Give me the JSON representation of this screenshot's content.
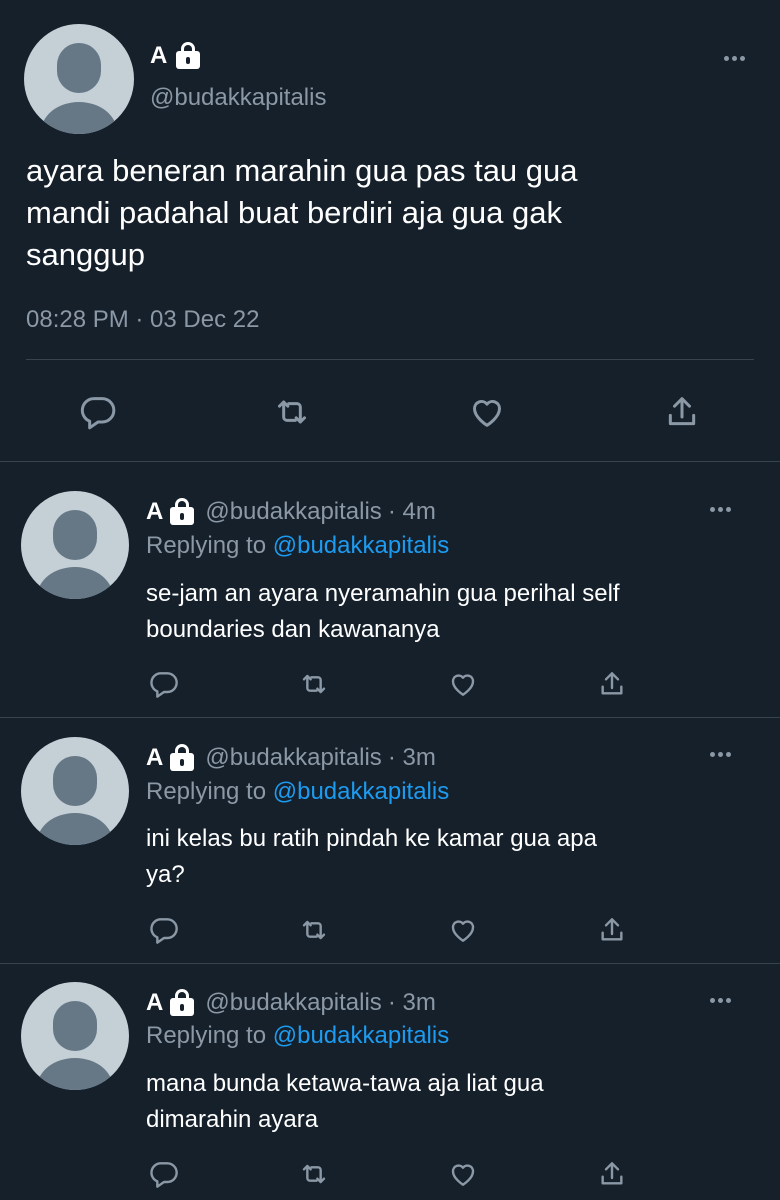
{
  "main_tweet": {
    "name": "A",
    "handle": "@budakkapitalis",
    "text_lines": [
      "ayara beneran marahin gua pas tau gua",
      "mandi padahal buat berdiri aja gua gak",
      "sanggup"
    ],
    "timestamp": "08:28 PM · 03 Dec 22"
  },
  "replies": [
    {
      "name": "A",
      "handle": "@budakkapitalis",
      "time": "· 4m",
      "replying_label": "Replying to",
      "replying_handle": "@budakkapitalis",
      "text_lines": [
        "se-jam an ayara nyeramahin gua perihal self",
        "boundaries dan kawananya"
      ]
    },
    {
      "name": "A",
      "handle": "@budakkapitalis",
      "time": "· 3m",
      "replying_label": "Replying to",
      "replying_handle": "@budakkapitalis",
      "text_lines": [
        "ini kelas bu ratih pindah ke kamar gua apa",
        "ya?"
      ]
    },
    {
      "name": "A",
      "handle": "@budakkapitalis",
      "time": "· 3m",
      "replying_label": "Replying to",
      "replying_handle": "@budakkapitalis",
      "text_lines": [
        "mana bunda ketawa-tawa aja liat gua",
        "dimarahin ayara"
      ]
    }
  ],
  "icons": {
    "reply": "reply-icon",
    "retweet": "retweet-icon",
    "like": "like-icon",
    "share": "share-icon",
    "lock": "lock-icon",
    "more": "more-icon"
  },
  "colors": {
    "background": "#15202b",
    "text": "#ffffff",
    "muted": "#8b98a5",
    "link": "#1d9bf0",
    "divider": "#38444d",
    "avatar_bg": "#c4cfd6",
    "avatar_fg": "#667786"
  }
}
